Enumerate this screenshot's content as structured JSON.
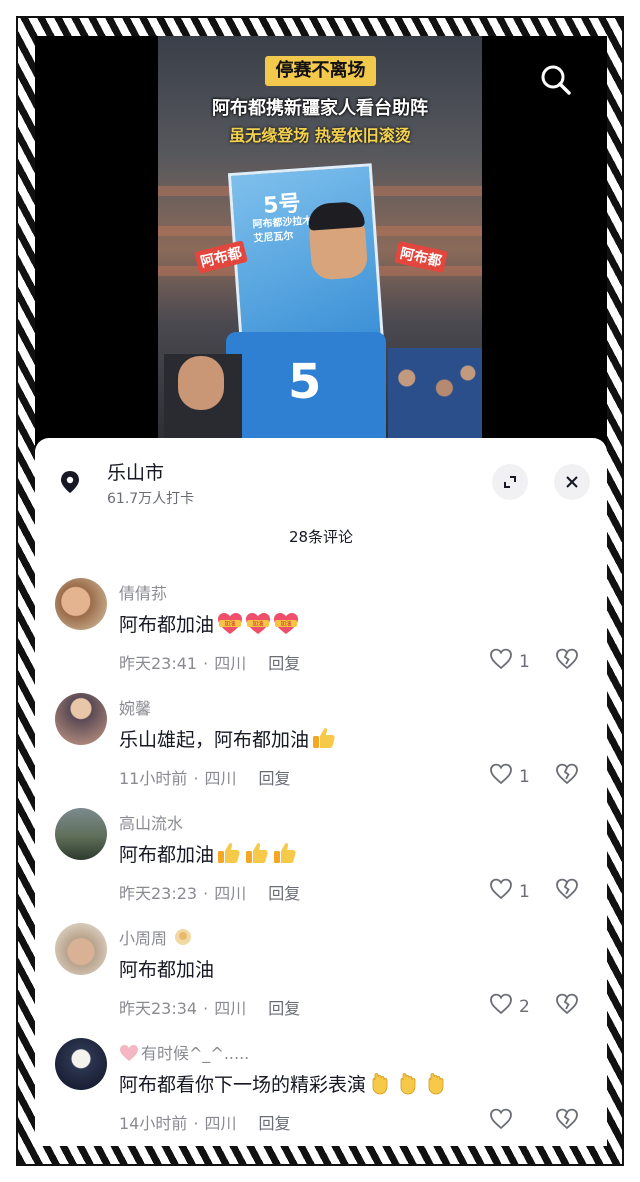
{
  "video": {
    "tag": "停赛不离场",
    "headline": "阿布都携新疆家人看台助阵",
    "subline": "虽无缘登场  热爱依旧滚烫",
    "banner_number": "5号",
    "banner_name_1": "阿布都沙拉木",
    "banner_name_2": "艾尼瓦尔",
    "side_label_left": "阿布都",
    "side_label_right": "阿布都",
    "jersey_number": "5"
  },
  "location": {
    "title": "乐山市",
    "subtitle": "61.7万人打卡"
  },
  "comments_count": "28条评论",
  "comments": [
    {
      "user": "倩倩荪",
      "text": "阿布都加油",
      "time": "昨天23:41",
      "region": "四川",
      "reply": "回复",
      "likes": "1",
      "emoji_count": 3
    },
    {
      "user": "婉馨",
      "text": "乐山雄起，阿布都加油",
      "time": "11小时前",
      "region": "四川",
      "reply": "回复",
      "likes": "1",
      "emoji_count": 1
    },
    {
      "user": "高山流水",
      "text": "阿布都加油",
      "time": "昨天23:23",
      "region": "四川",
      "reply": "回复",
      "likes": "1",
      "emoji_count": 3
    },
    {
      "user": "小周周",
      "text": "阿布都加油",
      "time": "昨天23:34",
      "region": "四川",
      "reply": "回复",
      "likes": "2",
      "emoji_count": 0
    },
    {
      "user": "有时候^_^.....",
      "text": "阿布都看你下一场的精彩表演",
      "time": "14小时前",
      "region": "四川",
      "reply": "回复",
      "likes": "",
      "emoji_count": 3
    }
  ],
  "colors": {
    "tag_bg": "#f2c94c",
    "subline": "#f3d24f",
    "text_primary": "#161823",
    "text_secondary": "#8a8b91"
  },
  "icons": [
    "search-icon",
    "location-pin-icon",
    "expand-icon",
    "close-icon",
    "heart-icon",
    "dislike-icon"
  ]
}
